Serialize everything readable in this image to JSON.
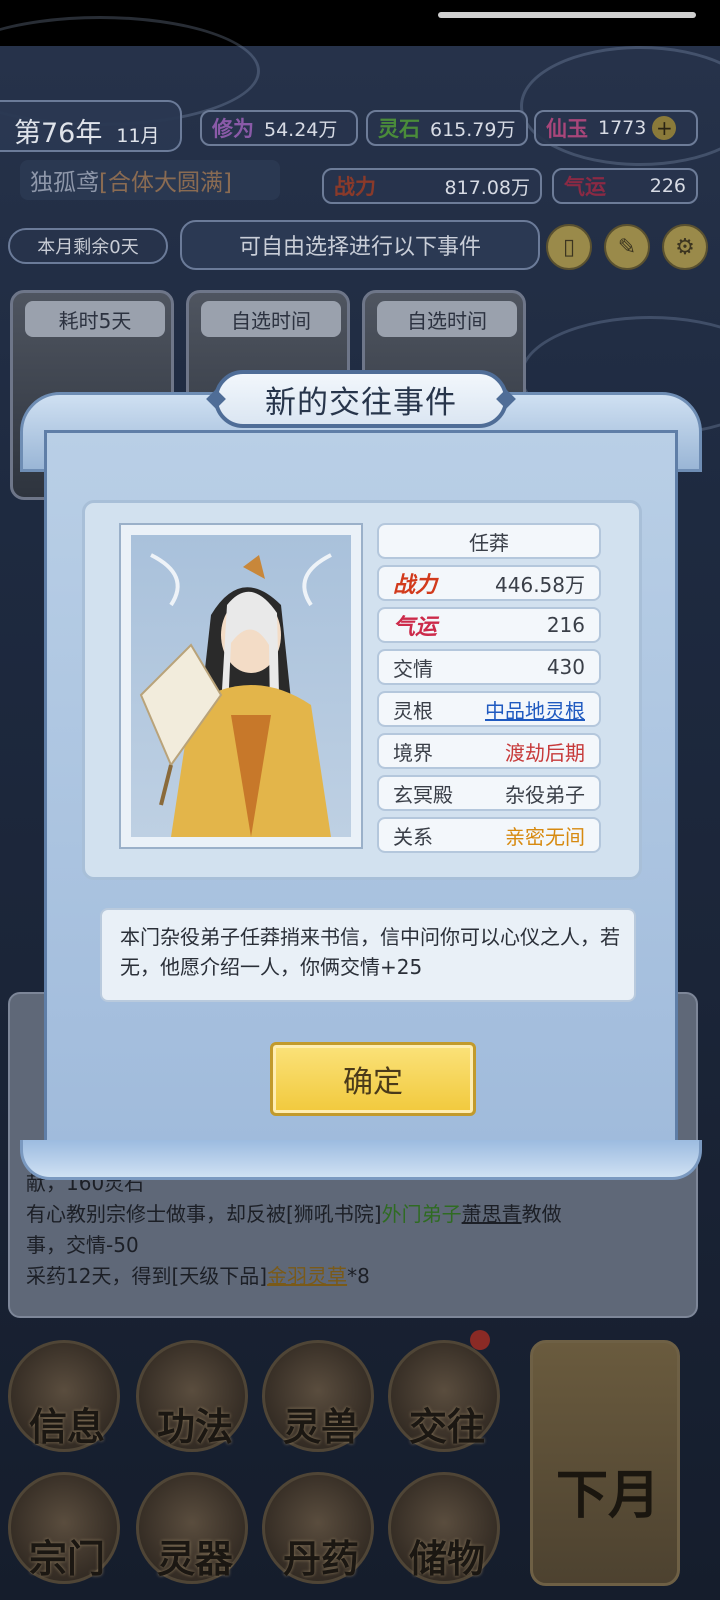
{
  "hud": {
    "year": "第76年",
    "month": "11月",
    "cultivation_label": "修为",
    "cultivation_value": "54.24万",
    "spirit_stone_label": "灵石",
    "spirit_stone_value": "615.79万",
    "jade_label": "仙玉",
    "jade_value": "1773",
    "player_name": "独孤鸢",
    "player_realm": "[合体大圆满]",
    "power_label": "战力",
    "power_value": "817.08万",
    "luck_label": "气运",
    "luck_value": "226",
    "remaining_days": "本月剩余0天",
    "event_hint": "可自由选择进行以下事件"
  },
  "event_cards": [
    {
      "tag": "耗时5天"
    },
    {
      "tag": "自选时间"
    },
    {
      "tag": "自选时间"
    }
  ],
  "log": {
    "line1": "献，160灵石",
    "line2_a": "有心教别宗修士做事，却反被[狮吼书院]",
    "line2_b": "外门弟子",
    "line2_c": "萧思青",
    "line2_d": "教做",
    "line3": "事，交情-50",
    "line4_a": "采药12天，得到[天级下品]",
    "line4_b": "金羽灵草",
    "line4_c": "*8"
  },
  "menu": {
    "info": "信息",
    "technique": "功法",
    "beast": "灵兽",
    "social": "交往",
    "sect": "宗门",
    "artifact": "灵器",
    "pill": "丹药",
    "storage": "储物",
    "next_month": "下月"
  },
  "modal": {
    "title": "新的交往事件",
    "npc_name": "任莽",
    "power_label": "战力",
    "power_value": "446.58万",
    "luck_label": "气运",
    "luck_value": "216",
    "friendship_label": "交情",
    "friendship_value": "430",
    "root_label": "灵根",
    "root_value": "中品地灵根",
    "realm_label": "境界",
    "realm_value": "渡劫后期",
    "sect_label": "玄冥殿",
    "sect_value": "杂役弟子",
    "relation_label": "关系",
    "relation_value": "亲密无间",
    "description": "本门杂役弟子任莽捎来书信，信中问你可以心仪之人，若无，他愿介绍一人，你俩交情+25",
    "confirm": "确定"
  }
}
